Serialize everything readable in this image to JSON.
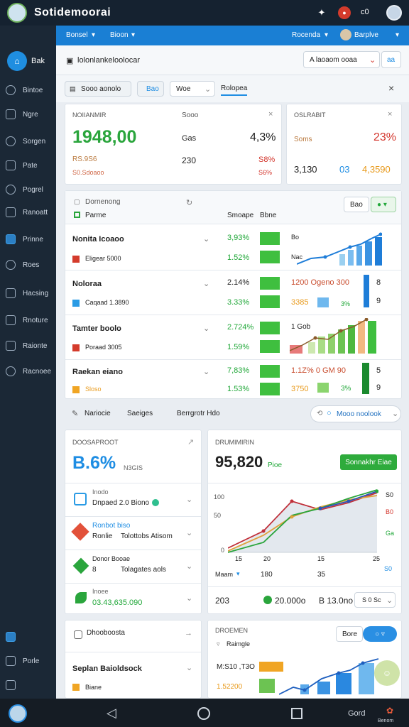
{
  "app": {
    "title": "Sotidemoorai",
    "top_right_count": "c0"
  },
  "sidebar": {
    "back_label": "Bak",
    "items": [
      "Bintoe",
      "Ngre",
      "Sorgen",
      "Pate",
      "Pogrel",
      "Ranoatt",
      "Prinne",
      "Roes",
      "Hacsing",
      "Rnoture",
      "Raionte",
      "Racnoee"
    ],
    "bottom_items": [
      "Porle"
    ]
  },
  "bluebar": {
    "left1": "Bonsel",
    "left2": "Bioon",
    "right1": "Rocenda",
    "right2": "Barplve"
  },
  "page": {
    "title": "lolonlankeloolocar",
    "header_btn": "A laoaom ooaa",
    "header_btn2": "aa"
  },
  "filters": {
    "f1": "Sooo aonolo",
    "f2": "Bao",
    "f3": "Woe",
    "f4": "Rolopea"
  },
  "kpi1": {
    "label": "NOIIANMIR",
    "big": "1948,00",
    "sub1": "RS.9S6",
    "sub2": "S0.Sdoaoo",
    "col2_label": "Sooo",
    "col2_v1": "Gas",
    "col2_v2": "230",
    "pct": "4,3%",
    "pct2": "S8%",
    "pct3": "S6%"
  },
  "kpi2": {
    "label": "OSLRABIT",
    "sub": "Soms",
    "pct": "23%",
    "v1": "3,130",
    "v2": "03",
    "v3": "4,3590"
  },
  "table": {
    "head": "Dornenong",
    "col0": "Parme",
    "col1": "Smoape",
    "col2": "Bbne",
    "rows": [
      {
        "name": "Nonita Icoaoo",
        "sub": "Eligear 5000",
        "p1": "3,93%",
        "p2": "1.52%",
        "m1": "Bo",
        "m2": "Nac"
      },
      {
        "name": "Noloraa",
        "sub": "Caqaad 1.3890",
        "p1": "2.14%",
        "p2": "3.33%",
        "m1": "1200 Ogeno 300",
        "m2": "3385",
        "m3": "8",
        "m4": "9"
      },
      {
        "name": "Tamter boolo",
        "sub": "Poraad 3005",
        "p1": "2.724%",
        "p2": "1.59%",
        "m1": "1 Gob"
      },
      {
        "name": "Raekan eiano",
        "sub": "Sloso",
        "p1": "7,83%",
        "p2": "1.53%",
        "m1": "1.1Z% 0 GM 90",
        "m2": "3750",
        "m3": "3%",
        "m4": "5",
        "m5": "9"
      }
    ]
  },
  "toolbar": {
    "t1": "Nariocie",
    "t2": "Saeiges",
    "t3": "Berrgrotr Hdo",
    "search": "Mooo noolook"
  },
  "panel3": {
    "label": "DOOSAPROOT",
    "pct": "B.6%",
    "pct_sub": "N3GIS",
    "items": [
      {
        "l1": "Inodo",
        "l2": "Dnpaed 2.0 Biono"
      },
      {
        "l1": "Ronbot biso",
        "l2": "Ronlie",
        "l3": "Tolottobs Atisom"
      },
      {
        "l1": "Donor Booae",
        "l2": "8",
        "l3": "Tolagates aols"
      },
      {
        "l1": "Inoee",
        "l2": "03.43,635.090"
      }
    ]
  },
  "panel4": {
    "label": "DRUMIMIRIN",
    "big": "95,820",
    "big_sub": "Pioe",
    "button": "Sonnakhr Eiae",
    "y1": "100",
    "y2": "50",
    "y3": "0",
    "xa": "15",
    "xb": "20",
    "xc": "15",
    "xd": "25",
    "x_sel": "Maam",
    "x2": "180",
    "x3": "35",
    "r1": "S0",
    "r2": "B0",
    "r3": "Ga",
    "r4": "S0",
    "foot1": "203",
    "foot2": "20.000o",
    "foot3": "B 13.0no",
    "foot_sel": "S 0 Sc"
  },
  "panel5": {
    "label": "Dhooboosta",
    "row": "Seplan Baioldsock",
    "sub": "Biane"
  },
  "panel6": {
    "label": "DROEMEN",
    "sub": "Raimgle",
    "btn": "Bore",
    "val": "M:S10 ,T3O",
    "val2": "1.52200"
  },
  "bottom": {
    "right_text": "Gord",
    "app_badge": "Benom"
  }
}
